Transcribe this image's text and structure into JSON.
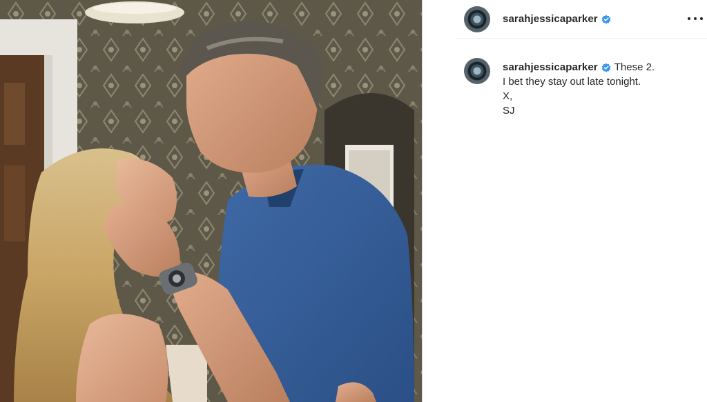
{
  "post": {
    "username": "sarahjessicaparker",
    "verified_icon": "verified-badge-icon",
    "more_icon": "more-options-icon",
    "accent": "#3897f0"
  },
  "caption": {
    "username": "sarahjessicaparker",
    "lines": [
      "These 2.",
      "I bet they stay out late tonight.",
      "X,",
      "SJ"
    ]
  },
  "photo": {
    "subject_icon": "post-photo"
  }
}
